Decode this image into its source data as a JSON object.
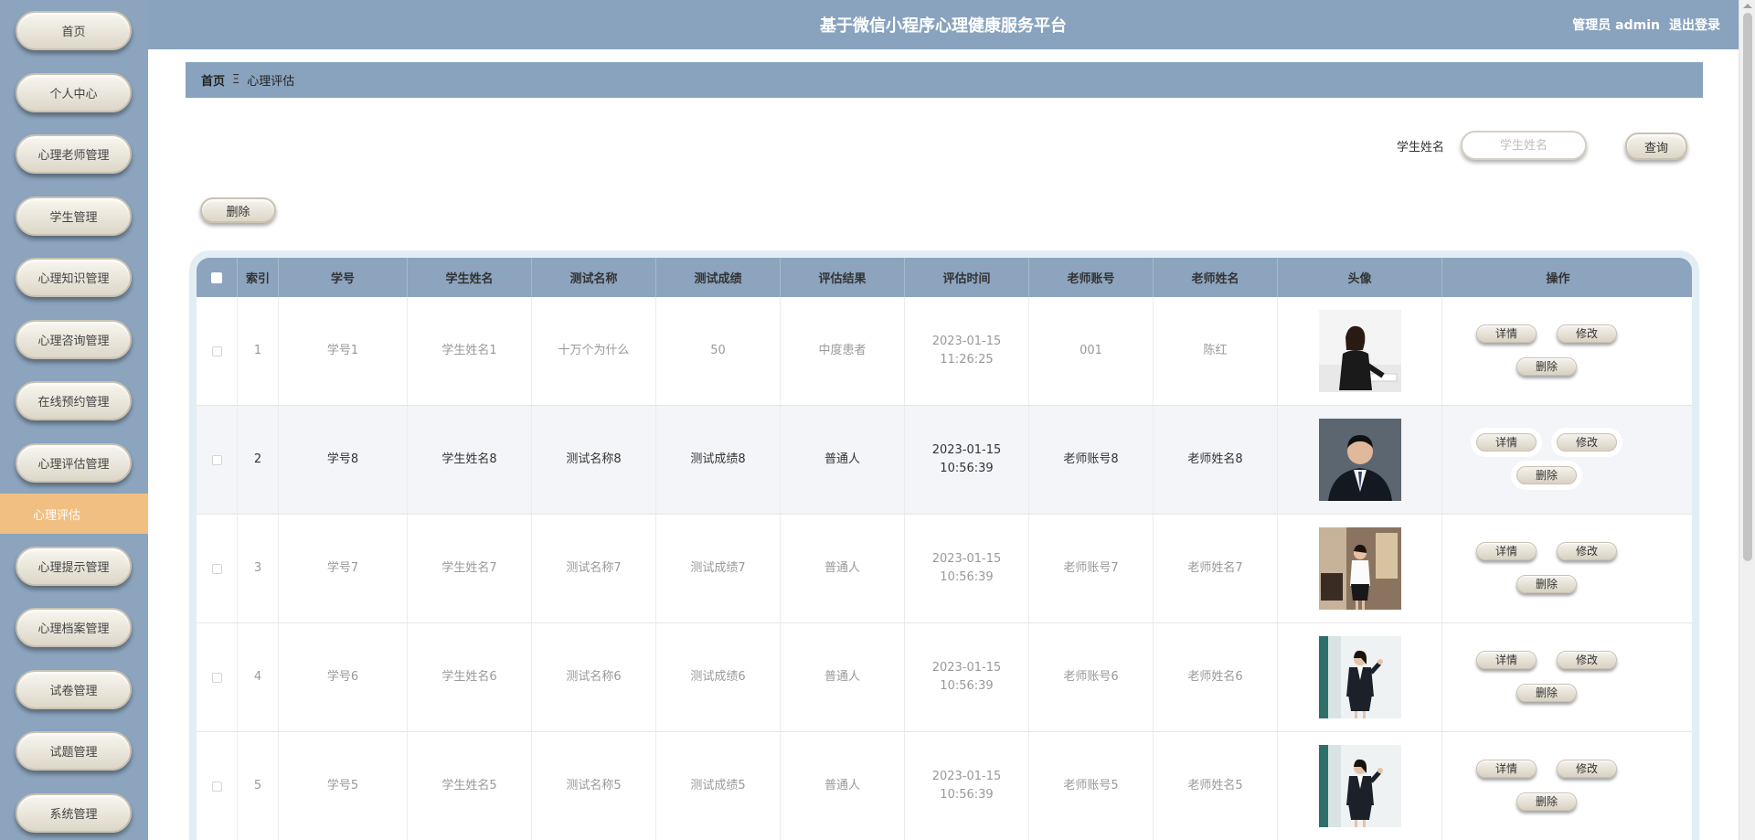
{
  "app": {
    "title": "基于微信小程序心理健康服务平台",
    "user_label": "管理员 admin",
    "logout_label": "退出登录"
  },
  "sidebar": {
    "items": [
      {
        "label": "首页"
      },
      {
        "label": "个人中心"
      },
      {
        "label": "心理老师管理"
      },
      {
        "label": "学生管理"
      },
      {
        "label": "心理知识管理"
      },
      {
        "label": "心理咨询管理"
      },
      {
        "label": "在线预约管理"
      },
      {
        "label": "心理评估管理"
      },
      {
        "label": "心理提示管理"
      },
      {
        "label": "心理档案管理"
      },
      {
        "label": "试卷管理"
      },
      {
        "label": "试题管理"
      },
      {
        "label": "系统管理"
      }
    ],
    "active_sub": "心理评估"
  },
  "breadcrumb": {
    "home": "首页",
    "separator": "Ξ",
    "current": "心理评估"
  },
  "search": {
    "label": "学生姓名",
    "placeholder": "学生姓名",
    "value": "",
    "query_label": "查询"
  },
  "toolbar": {
    "delete_label": "删除"
  },
  "table": {
    "columns": [
      "索引",
      "学号",
      "学生姓名",
      "测试名称",
      "测试成绩",
      "评估结果",
      "评估时间",
      "老师账号",
      "老师姓名",
      "头像",
      "操作"
    ],
    "rows": [
      {
        "index": "1",
        "student_no": "学号1",
        "student_name": "学生姓名1",
        "test_name": "十万个为什么",
        "score": "50",
        "result": "中度患者",
        "time": "2023-01-15 11:26:25",
        "teacher_account": "001",
        "teacher_name": "陈红",
        "avatar": "woman-at-desk"
      },
      {
        "index": "2",
        "student_no": "学号8",
        "student_name": "学生姓名8",
        "test_name": "测试名称8",
        "score": "测试成绩8",
        "result": "普通人",
        "time": "2023-01-15 10:56:39",
        "teacher_account": "老师账号8",
        "teacher_name": "老师姓名8",
        "avatar": "man-in-suit"
      },
      {
        "index": "3",
        "student_no": "学号7",
        "student_name": "学生姓名7",
        "test_name": "测试名称7",
        "score": "测试成绩7",
        "result": "普通人",
        "time": "2023-01-15 10:56:39",
        "teacher_account": "老师账号7",
        "teacher_name": "老师姓名7",
        "avatar": "woman-in-office"
      },
      {
        "index": "4",
        "student_no": "学号6",
        "student_name": "学生姓名6",
        "test_name": "测试名称6",
        "score": "测试成绩6",
        "result": "普通人",
        "time": "2023-01-15 10:56:39",
        "teacher_account": "老师账号6",
        "teacher_name": "老师姓名6",
        "avatar": "woman-in-suit"
      },
      {
        "index": "5",
        "student_no": "学号5",
        "student_name": "学生姓名5",
        "test_name": "测试名称5",
        "score": "测试成绩5",
        "result": "普通人",
        "time": "2023-01-15 10:56:39",
        "teacher_account": "老师账号5",
        "teacher_name": "老师姓名5",
        "avatar": "woman-in-suit"
      }
    ],
    "actions": {
      "detail": "详情",
      "edit": "修改",
      "delete": "删除"
    }
  },
  "colors": {
    "header_bg": "#89a3be",
    "sidebar_bg": "#8ca4be",
    "active_item": "#f2bf83"
  }
}
